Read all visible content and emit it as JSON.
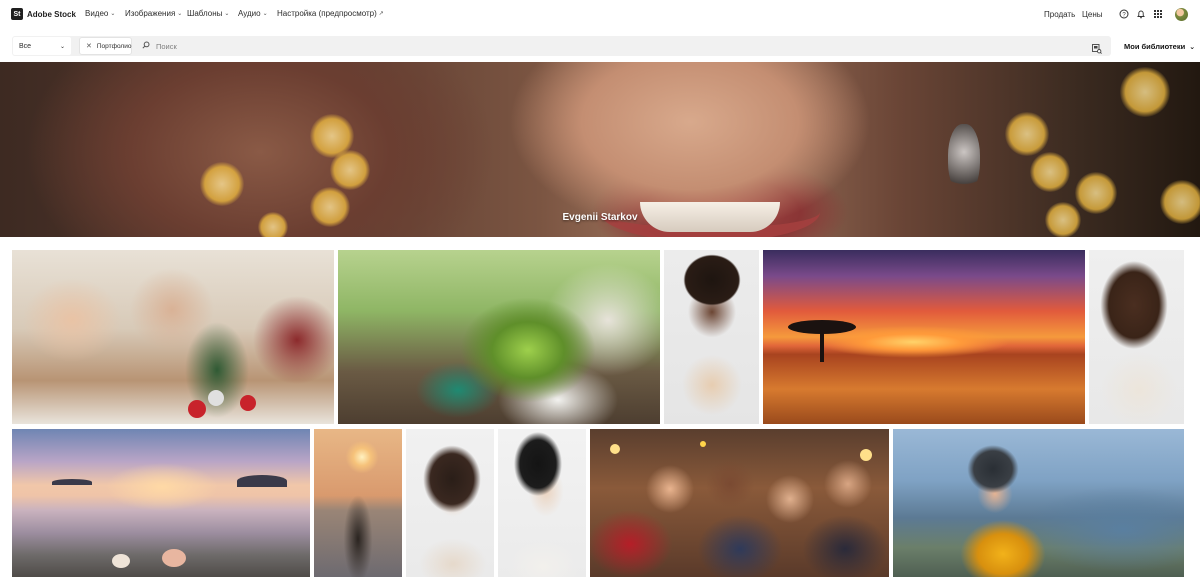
{
  "brand": {
    "logo_mark": "St",
    "name": "Adobe Stock"
  },
  "nav": [
    {
      "label": "Видео",
      "has_menu": true
    },
    {
      "label": "Изображения",
      "has_menu": true
    },
    {
      "label": "Шаблоны",
      "has_menu": true
    },
    {
      "label": "Аудио",
      "has_menu": true
    },
    {
      "label": "Настройка (предпросмотр)",
      "external": true
    }
  ],
  "header_right": {
    "sell": "Продать",
    "pricing": "Цены",
    "icons": [
      "help-icon",
      "bell-icon",
      "apps-grid-icon",
      "avatar"
    ]
  },
  "search": {
    "category": "Все",
    "filter_chip": "Портфолио",
    "placeholder": "Поиск",
    "value": "",
    "my_libraries": "Мои библиотеки"
  },
  "hero": {
    "contributor_name": "Evgenii Starkov"
  },
  "gallery": {
    "tiles": [
      "family-christmas-decorating",
      "elderly-woman-planting-seedling",
      "woman-portrait-lingerie",
      "african-savanna-sunset",
      "woman-portrait-hands-on-neck",
      "beach-sunset-shells",
      "woman-sea-sunset",
      "woman-beauty-portrait",
      "asian-woman-profile",
      "new-year-party-confetti",
      "paraglider-woman-helmet"
    ]
  },
  "colors": {
    "accent": "#1f1f1f",
    "search_bg": "#f1f1f1"
  }
}
